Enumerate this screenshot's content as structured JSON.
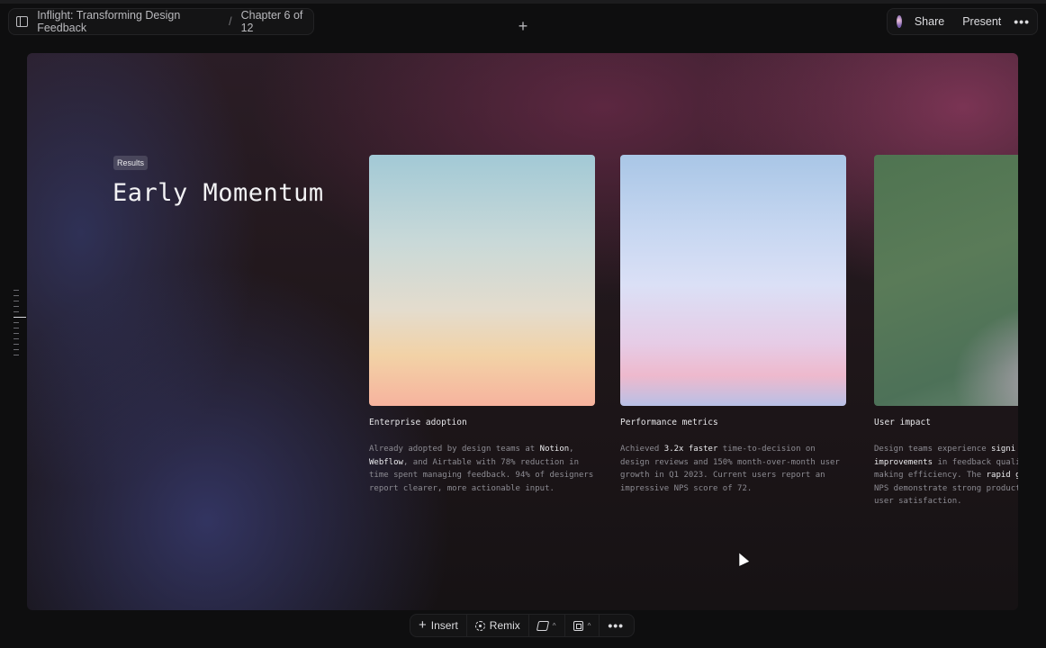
{
  "header": {
    "breadcrumb_doc": "Inflight: Transforming Design Feedback",
    "breadcrumb_sep": "/",
    "breadcrumb_chapter": "Chapter 6 of 12",
    "add_label": "+",
    "share_label": "Share",
    "present_label": "Present",
    "more_label": "•••"
  },
  "slide": {
    "tag": "Results",
    "title": "Early Momentum",
    "cards": [
      {
        "title": "Enterprise adoption",
        "desc": [
          [
            {
              "t": "Already adopted by design teams at "
            },
            {
              "t": "Notion",
              "hi": true
            },
            {
              "t": ","
            }
          ],
          [
            {
              "t": "Webflow",
              "hi": true
            },
            {
              "t": ", and Airtable with 78% reduction in"
            }
          ],
          [
            {
              "t": "time spent managing feedback. 94% of designers"
            }
          ],
          [
            {
              "t": "report clearer, more actionable input."
            }
          ]
        ]
      },
      {
        "title": "Performance metrics",
        "desc": [
          [
            {
              "t": "Achieved "
            },
            {
              "t": "3.2x faster",
              "hi": true
            },
            {
              "t": " time-to-decision on"
            }
          ],
          [
            {
              "t": "design reviews and 150% month-over-month user"
            }
          ],
          [
            {
              "t": "growth in Q1 2023. Current users report an"
            }
          ],
          [
            {
              "t": "impressive NPS score of 72."
            }
          ]
        ]
      },
      {
        "title": "User impact",
        "desc": [
          [
            {
              "t": "Design teams experience "
            },
            {
              "t": "signi",
              "hi": true
            }
          ],
          [
            {
              "t": "improvements",
              "hi": true
            },
            {
              "t": " in feedback quali"
            }
          ],
          [
            {
              "t": "making efficiency. The "
            },
            {
              "t": "rapid g",
              "hi": true
            }
          ],
          [
            {
              "t": "NPS demonstrate strong product"
            }
          ],
          [
            {
              "t": "user satisfaction."
            }
          ]
        ]
      }
    ]
  },
  "toolbar": {
    "insert_label": "Insert",
    "remix_label": "Remix",
    "caret": "^",
    "more_label": "•••"
  },
  "scrubber": {
    "count": 13,
    "active_index": 5
  }
}
